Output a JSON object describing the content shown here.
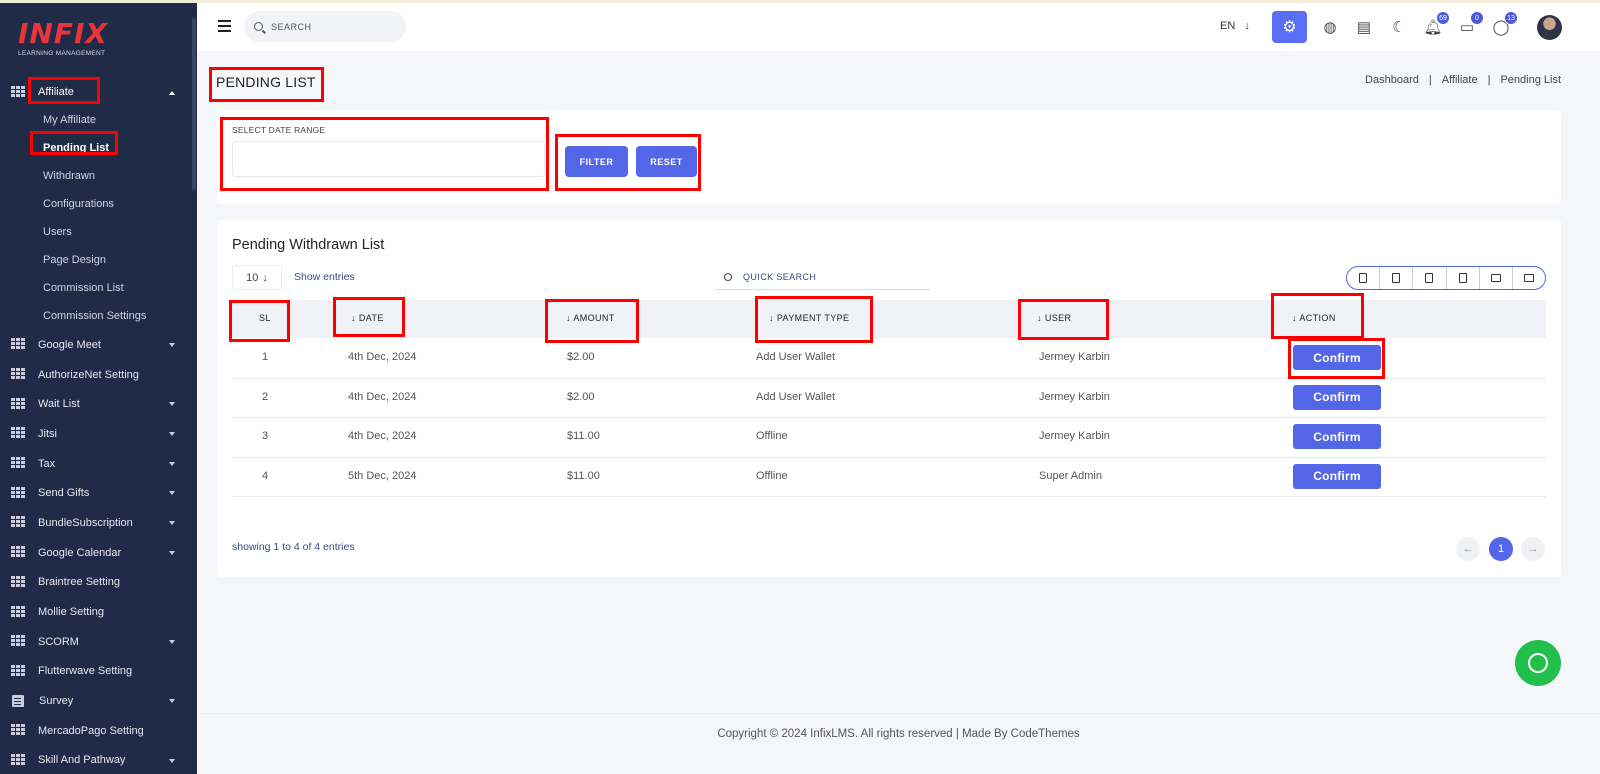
{
  "brand": {
    "logo": "INFIX",
    "tagline": "LEARNING MANAGEMENT"
  },
  "sidebar": {
    "active_group": {
      "label": "Affiliate"
    },
    "submenu": [
      {
        "label": "My Affiliate"
      },
      {
        "label": "Pending List"
      },
      {
        "label": "Withdrawn"
      },
      {
        "label": "Configurations"
      },
      {
        "label": "Users"
      },
      {
        "label": "Page Design"
      },
      {
        "label": "Commission List"
      },
      {
        "label": "Commission Settings"
      }
    ],
    "items": [
      {
        "label": "Google Meet",
        "has_caret": true
      },
      {
        "label": "AuthorizeNet Setting",
        "has_caret": false
      },
      {
        "label": "Wait List",
        "has_caret": true
      },
      {
        "label": "Jitsi",
        "has_caret": true
      },
      {
        "label": "Tax",
        "has_caret": true
      },
      {
        "label": "Send Gifts",
        "has_caret": true
      },
      {
        "label": "BundleSubscription",
        "has_caret": true
      },
      {
        "label": "Google Calendar",
        "has_caret": true
      },
      {
        "label": "Braintree Setting",
        "has_caret": false
      },
      {
        "label": "Mollie Setting",
        "has_caret": false
      },
      {
        "label": "SCORM",
        "has_caret": true
      },
      {
        "label": "Flutterwave Setting",
        "has_caret": false
      },
      {
        "label": "Survey",
        "has_caret": true
      },
      {
        "label": "MercadoPago Setting",
        "has_caret": false
      },
      {
        "label": "Skill And Pathway",
        "has_caret": true
      }
    ]
  },
  "topbar": {
    "search_placeholder": "SEARCH",
    "language": "EN",
    "notifications_count": "69",
    "messages_count": "0",
    "whatsapp_count": "13"
  },
  "page": {
    "title": "PENDING LIST",
    "breadcrumb": [
      "Dashboard",
      "Affiliate",
      "Pending List"
    ]
  },
  "filter": {
    "date_range_label": "SELECT DATE RANGE",
    "date_range_value": "",
    "filter_label": "FILTER",
    "reset_label": "RESET"
  },
  "list": {
    "title": "Pending Withdrawn List",
    "entries_value": "10",
    "entries_label": "Show entries",
    "quick_search_placeholder": "QUICK SEARCH",
    "columns": [
      "SL",
      "DATE",
      "AMOUNT",
      "PAYMENT TYPE",
      "USER",
      "ACTION"
    ],
    "rows": [
      {
        "sl": "1",
        "date": "4th Dec, 2024",
        "amount": "$2.00",
        "payment_type": "Add User Wallet",
        "user": "Jermey Karbin",
        "action": "Confirm"
      },
      {
        "sl": "2",
        "date": "4th Dec, 2024",
        "amount": "$2.00",
        "payment_type": "Add User Wallet",
        "user": "Jermey Karbin",
        "action": "Confirm"
      },
      {
        "sl": "3",
        "date": "4th Dec, 2024",
        "amount": "$11.00",
        "payment_type": "Offline",
        "user": "Jermey Karbin",
        "action": "Confirm"
      },
      {
        "sl": "4",
        "date": "5th Dec, 2024",
        "amount": "$11.00",
        "payment_type": "Offline",
        "user": "Super Admin",
        "action": "Confirm"
      }
    ],
    "showing_text": "showing 1 to 4 of 4 entries",
    "current_page": "1"
  },
  "footer": {
    "text": "Copyright © 2024 InfixLMS. All rights reserved | Made By CodeThemes"
  },
  "colors": {
    "sidebar_bg": "#202b47",
    "accent": "#5466e8",
    "highlight": "#ff0000",
    "whatsapp": "#22c04a"
  }
}
